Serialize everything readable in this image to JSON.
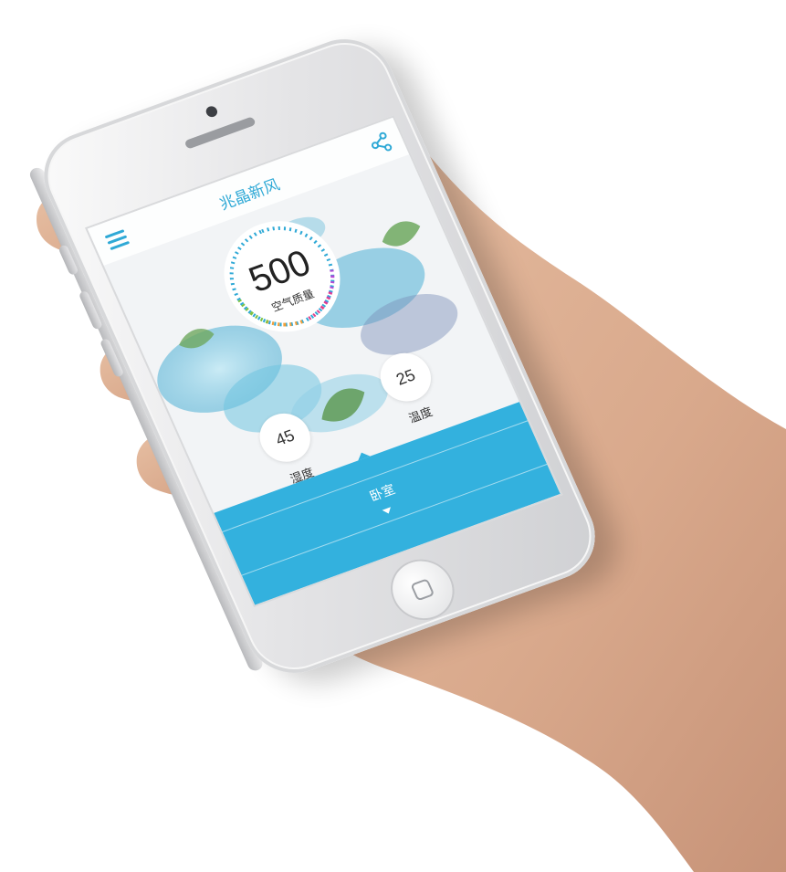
{
  "app": {
    "title": "兆晶新风"
  },
  "header": {
    "menu_icon": "hamburger-menu-icon",
    "share_icon": "share-icon"
  },
  "air_quality": {
    "value": "500",
    "label": "空气质量"
  },
  "humidity": {
    "value": "45",
    "label": "湿度"
  },
  "temperature": {
    "value": "25",
    "label": "温度"
  },
  "room": {
    "label": "卧室",
    "dropdown_icon": "caret-down-icon"
  },
  "colors": {
    "accent": "#33b1de",
    "title": "#2fa9d6",
    "device": "#e4e4e6"
  }
}
